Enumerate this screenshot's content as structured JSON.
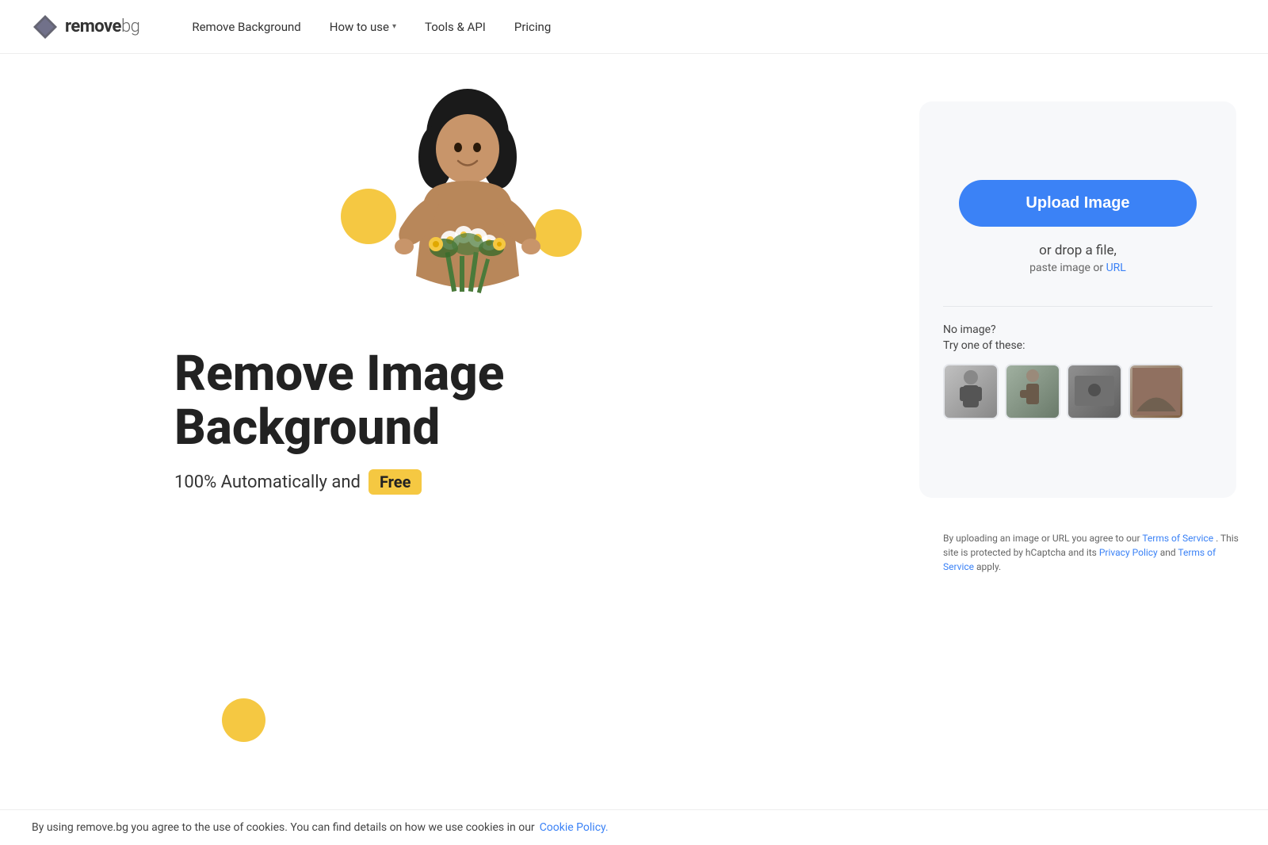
{
  "site": {
    "logo_remove": "remove",
    "logo_bg": "bg"
  },
  "nav": {
    "remove_background_label": "Remove Background",
    "how_to_use_label": "How to use",
    "tools_api_label": "Tools & API",
    "pricing_label": "Pricing"
  },
  "hero": {
    "title_line1": "Remove Image",
    "title_line2": "Background",
    "subtitle": "100% Automatically and",
    "free_badge": "Free"
  },
  "upload": {
    "button_label": "Upload Image",
    "drop_text": "or drop a file,",
    "paste_text": "paste image or",
    "paste_url_label": "URL"
  },
  "samples": {
    "label_line1": "No image?",
    "label_line2": "Try one of these:"
  },
  "terms": {
    "text_before_link": "By uploading an image or URL you agree to our",
    "terms_of_service_label": "Terms of Service",
    "text_middle": ". This site is protected by hCaptcha and its",
    "privacy_policy_label": "Privacy Policy",
    "text_and": "and",
    "terms_of_service_label2": "Terms of Service",
    "text_apply": "apply."
  },
  "cookie": {
    "text": "By using remove.bg you agree to the use of cookies. You can find details on how we use cookies in our",
    "link_label": "Cookie Policy."
  }
}
